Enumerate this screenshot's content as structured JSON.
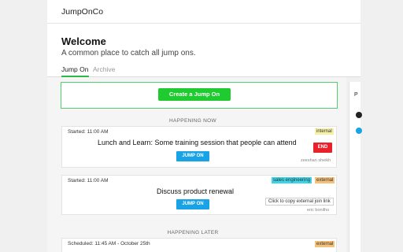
{
  "app": {
    "brand": "JumpOnCo"
  },
  "header": {
    "title": "Welcome",
    "subtitle": "A common place to catch all jump ons.",
    "tabs": [
      {
        "label": "Jump On",
        "active": true
      },
      {
        "label": "Archive",
        "active": false
      }
    ]
  },
  "create": {
    "label": "Create a Jump On"
  },
  "sections": {
    "now": "HAPPENING NOW",
    "later": "HAPPENING LATER"
  },
  "cards": [
    {
      "started": "Started: 11:00 AM",
      "tags": [
        "internal"
      ],
      "title": "Lunch and Learn: Some training session that people can attend",
      "jump_label": "JUMP ON",
      "end_label": "END",
      "author": "zeeshan sheikh"
    },
    {
      "started": "Started: 11:00 AM",
      "tags": [
        "sales engineering",
        "external"
      ],
      "title": "Discuss product renewal",
      "jump_label": "JUMP ON",
      "ext_link": "Click to copy external join link",
      "author": "eric bonilho"
    },
    {
      "started": "Scheduled: 11:45 AM - October 25th",
      "tags": [
        "external"
      ]
    }
  ],
  "side": {
    "letter": "P"
  },
  "colors": {
    "accent_green": "#1fcb2f",
    "jump_blue": "#17a3e6",
    "end_red": "#e8212b",
    "tab_underline": "#2eb84b"
  }
}
